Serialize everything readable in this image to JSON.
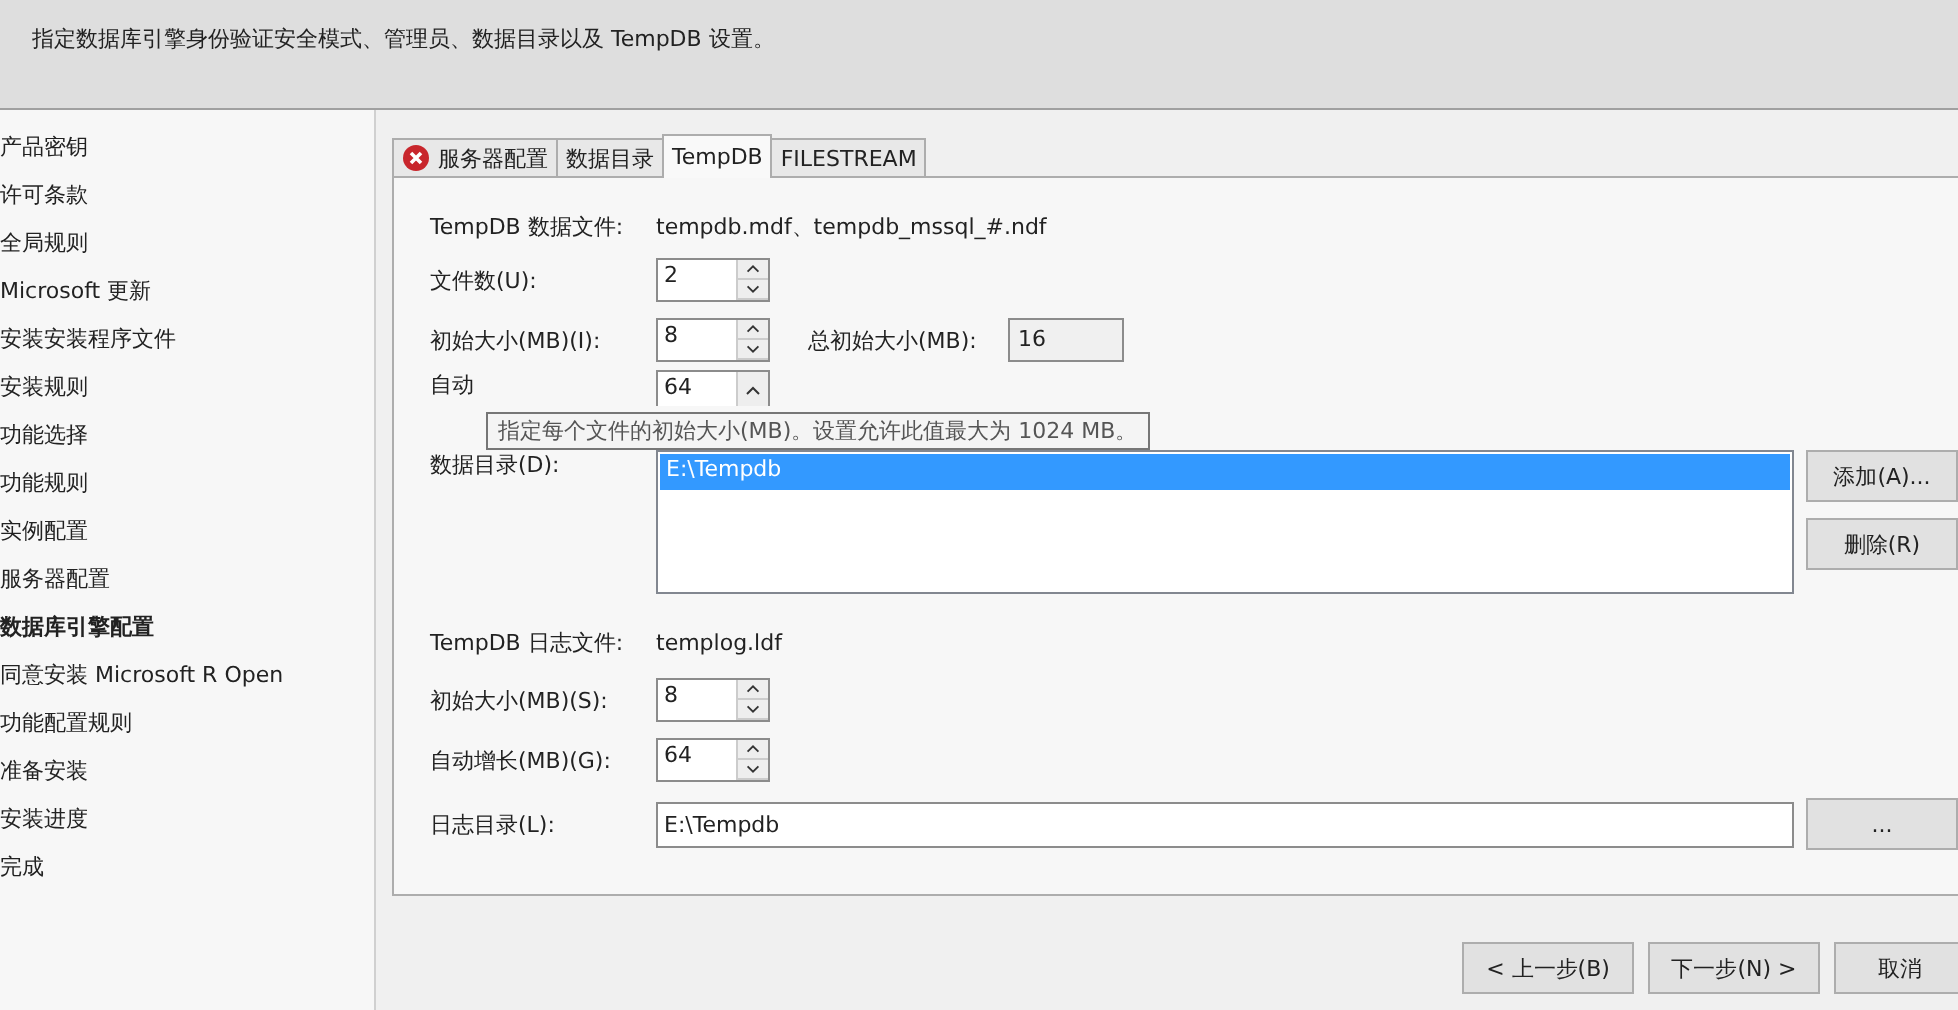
{
  "header": {
    "description": "指定数据库引擎身份验证安全模式、管理员、数据目录以及 TempDB 设置。"
  },
  "sidebar": {
    "items": [
      {
        "label": "产品密钥",
        "selected": false
      },
      {
        "label": "许可条款",
        "selected": false
      },
      {
        "label": "全局规则",
        "selected": false
      },
      {
        "label": "Microsoft 更新",
        "selected": false
      },
      {
        "label": "安装安装程序文件",
        "selected": false
      },
      {
        "label": "安装规则",
        "selected": false
      },
      {
        "label": "功能选择",
        "selected": false
      },
      {
        "label": "功能规则",
        "selected": false
      },
      {
        "label": "实例配置",
        "selected": false
      },
      {
        "label": "服务器配置",
        "selected": false
      },
      {
        "label": "数据库引擎配置",
        "selected": true
      },
      {
        "label": "同意安装 Microsoft R Open",
        "selected": false
      },
      {
        "label": "功能配置规则",
        "selected": false
      },
      {
        "label": "准备安装",
        "selected": false
      },
      {
        "label": "安装进度",
        "selected": false
      },
      {
        "label": "完成",
        "selected": false
      }
    ]
  },
  "tabs": [
    {
      "label": "服务器配置",
      "selected": false,
      "error": true
    },
    {
      "label": "数据目录",
      "selected": false,
      "error": false
    },
    {
      "label": "TempDB",
      "selected": true,
      "error": false
    },
    {
      "label": "FILESTREAM",
      "selected": false,
      "error": false
    }
  ],
  "data_files": {
    "label": "TempDB 数据文件:",
    "value": "tempdb.mdf、tempdb_mssql_#.ndf"
  },
  "file_count": {
    "label": "文件数(U):",
    "value": "2"
  },
  "initial_size": {
    "label": "初始大小(MB)(I):",
    "value": "8",
    "total_label": "总初始大小(MB):",
    "total_value": "16"
  },
  "autogrowth": {
    "label": "自动",
    "value": "64"
  },
  "tooltip": "指定每个文件的初始大小(MB)。设置允许此值最大为 1024 MB。",
  "data_directory": {
    "label": "数据目录(D):",
    "items": [
      {
        "text": "E:\\Tempdb",
        "selected": true
      }
    ],
    "buttons": [
      "添加(A)...",
      "删除(R)"
    ]
  },
  "log_file": {
    "label": "TempDB 日志文件:",
    "value": "templog.ldf"
  },
  "log_initial_size": {
    "label": "初始大小(MB)(S):",
    "value": "8"
  },
  "log_autogrowth": {
    "label": "自动增长(MB)(G):",
    "value": "64"
  },
  "log_directory": {
    "label": "日志目录(L):",
    "value": "E:\\Tempdb",
    "browse": "..."
  },
  "nav_buttons": [
    "< 上一步(B)",
    "下一步(N) >",
    "取消"
  ]
}
